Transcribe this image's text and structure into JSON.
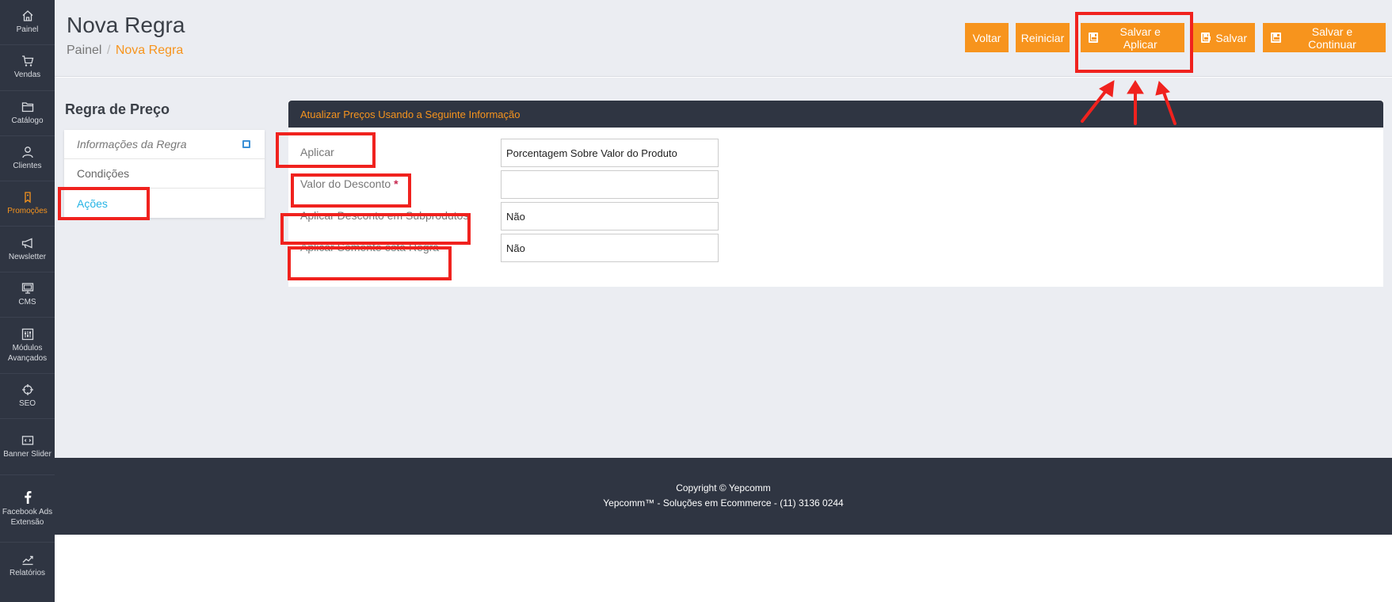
{
  "sidebar": {
    "items": [
      {
        "label": "Painel",
        "icon": "home-icon"
      },
      {
        "label": "Vendas",
        "icon": "cart-icon"
      },
      {
        "label": "Catálogo",
        "icon": "folder-icon"
      },
      {
        "label": "Clientes",
        "icon": "user-icon"
      },
      {
        "label": "Promoções",
        "icon": "tag-icon",
        "active": true
      },
      {
        "label": "Newsletter",
        "icon": "megaphone-icon"
      },
      {
        "label": "CMS",
        "icon": "monitor-icon"
      },
      {
        "label": "Módulos Avançados",
        "icon": "sliders-icon"
      },
      {
        "label": "SEO",
        "icon": "crosshair-icon"
      },
      {
        "label": "Banner Slider",
        "icon": "slider-icon"
      },
      {
        "label": "Facebook Ads Extensão",
        "icon": "facebook-icon"
      },
      {
        "label": "Relatórios",
        "icon": "chart-icon"
      }
    ]
  },
  "header": {
    "title": "Nova Regra",
    "breadcrumb": {
      "root": "Painel",
      "separator": "/",
      "current": "Nova Regra"
    },
    "buttons": {
      "back": "Voltar",
      "reset": "Reiniciar",
      "save_apply": "Salvar e Aplicar",
      "save": "Salvar",
      "save_continue": "Salvar e Continuar"
    }
  },
  "left": {
    "title": "Regra de Preço",
    "tabs": [
      {
        "label": "Informações da Regra"
      },
      {
        "label": "Condições"
      },
      {
        "label": "Ações"
      }
    ]
  },
  "panel": {
    "heading": "Atualizar Preços Usando a Seguinte Informação",
    "fields": [
      {
        "label": "Aplicar",
        "value": "Porcentagem Sobre Valor do Produto",
        "required": false
      },
      {
        "label": "Valor do Desconto",
        "value": "",
        "required": true,
        "required_mark": "*"
      },
      {
        "label": "Aplicar Desconto em Subprodutos",
        "value": "Não",
        "required": false
      },
      {
        "label": "Aplicar Somente esta Regra",
        "value": "Não",
        "required": false
      }
    ]
  },
  "footer": {
    "copyright": "Copyright © Yepcomm",
    "company": "Yepcomm™ - Soluções em Ecommerce - (11) 3136 0244"
  },
  "colors": {
    "accent": "#f7941d",
    "dark": "#2f3542",
    "background": "#ebedf2",
    "annotation": "#f0221e",
    "link": "#26b4e5"
  }
}
